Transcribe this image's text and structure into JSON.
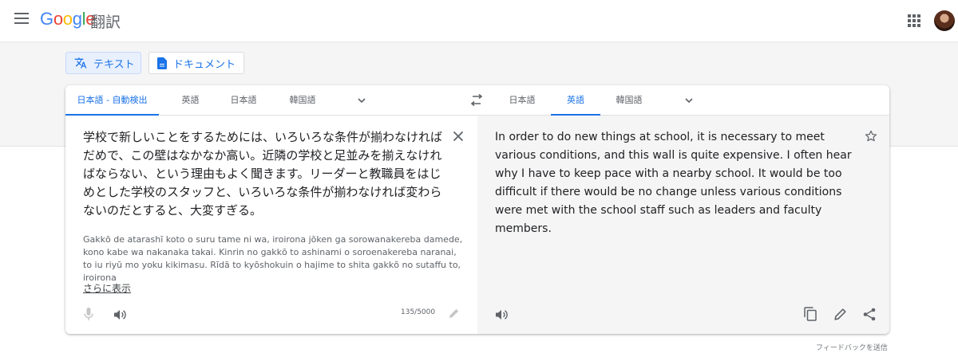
{
  "header": {
    "logo_letters": [
      "G",
      "o",
      "o",
      "g",
      "l",
      "e"
    ],
    "product": "翻訳"
  },
  "modes": {
    "text_label": "テキスト",
    "document_label": "ドキュメント"
  },
  "source": {
    "tabs": [
      "日本語 - 自動検出",
      "英語",
      "日本語",
      "韓国語"
    ],
    "active_index": 0,
    "text": "学校で新しいことをするためには、いろいろな条件が揃わなければだめで、この壁はなかなか高い。近隣の学校と足並みを揃えなければならない、という理由もよく聞きます。リーダーと教職員をはじめとした学校のスタッフと、いろいろな条件が揃わなければ変わらないのだとすると、大変すぎる。",
    "romanization": "Gakkō de atarashī koto o suru tame ni wa, iroirona jōken ga sorowanakereba damede, kono kabe wa nakanaka takai. Kinrin no gakkō to ashinami o soroenakereba naranai, to iu riyū mo yoku kikimasu. Rīdā to kyōshokuin o hajime to shita gakkō no sutaffu to, iroirona",
    "show_more": "さらに表示",
    "char_count": "135/5000"
  },
  "target": {
    "tabs": [
      "日本語",
      "英語",
      "韓国語"
    ],
    "active_index": 1,
    "text": "In order to do new things at school, it is necessary to meet various conditions, and this wall is quite expensive. I often hear why I have to keep pace with a nearby school. It would be too difficult if there would be no change unless various conditions were met with the school staff such as leaders and faculty members."
  },
  "footer": {
    "feedback": "フィードバックを送信"
  },
  "colors": {
    "accent": "#1a73e8",
    "band": "#f5f5f5",
    "target_bg": "#f5f5f5",
    "icon": "#5f6368"
  },
  "icons": [
    "menu-icon",
    "apps-grid-icon",
    "translate-icon",
    "document-icon",
    "chevron-down-icon",
    "swap-icon",
    "close-icon",
    "microphone-icon",
    "speaker-icon",
    "pencil-icon",
    "star-icon",
    "copy-icon",
    "share-icon"
  ]
}
